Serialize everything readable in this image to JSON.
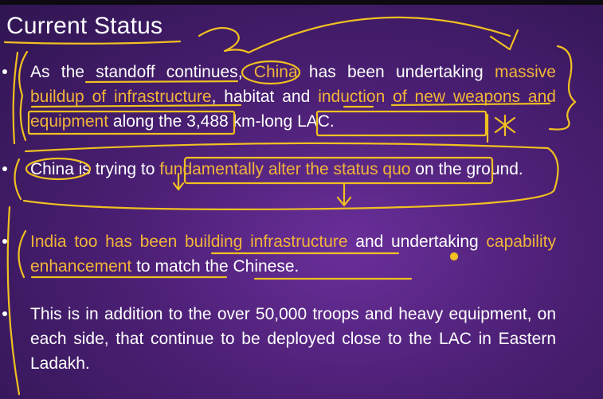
{
  "title": "Current Status",
  "bullets": [
    {
      "segments": [
        {
          "text": "As the ",
          "highlight": false
        },
        {
          "text": "standoff continues",
          "highlight": false
        },
        {
          "text": ", ",
          "highlight": false
        },
        {
          "text": "China",
          "highlight": true
        },
        {
          "text": " has been undertaking ",
          "highlight": false
        },
        {
          "text": "massive buildup of infrastructure",
          "highlight": true
        },
        {
          "text": ", habitat and ",
          "highlight": false
        },
        {
          "text": "induction of new weapons and equipment",
          "highlight": true
        },
        {
          "text": " along the 3,488 km-long LAC.",
          "highlight": false
        }
      ]
    },
    {
      "segments": [
        {
          "text": "China",
          "highlight": false
        },
        {
          "text": " is trying to ",
          "highlight": false
        },
        {
          "text": "fundamentally alter the status quo",
          "highlight": true
        },
        {
          "text": " on the ground.",
          "highlight": false
        }
      ]
    },
    {
      "segments": [
        {
          "text": "India too has been ",
          "highlight": true
        },
        {
          "text": "building infrastructure",
          "highlight": true
        },
        {
          "text": " and undertaking ",
          "highlight": false
        },
        {
          "text": "capability enhancement",
          "highlight": true
        },
        {
          "text": " to match the Chinese.",
          "highlight": false
        }
      ]
    },
    {
      "segments": [
        {
          "text": "This is in addition to the over 50,000 troops and heavy equipment, on each side, that continue to be deployed close to the LAC in Eastern Ladakh.",
          "highlight": false
        }
      ]
    }
  ],
  "colors": {
    "background": "#4b1f74",
    "text": "#ffffff",
    "highlight": "#f1b43a",
    "annotation_ink": "#f0c021"
  }
}
